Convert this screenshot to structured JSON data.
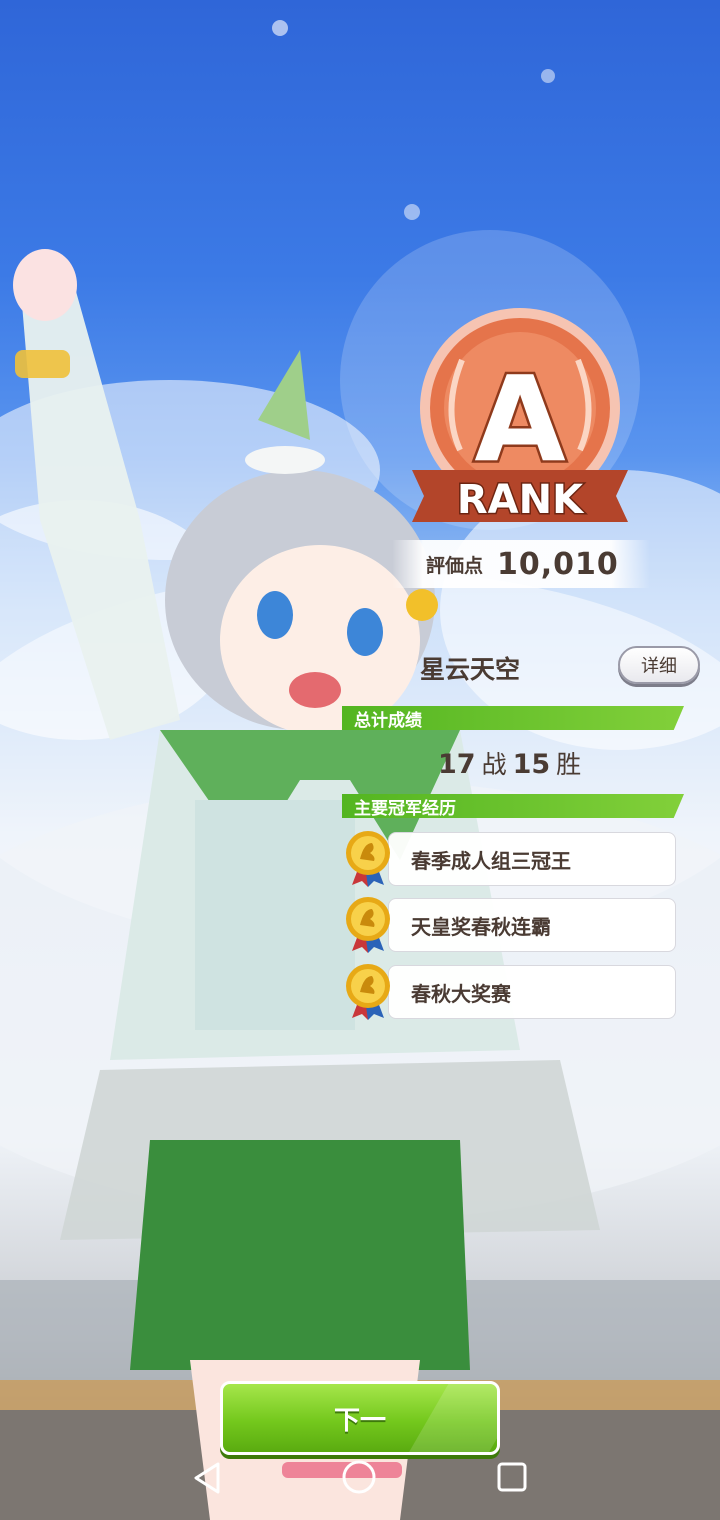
{
  "rank": {
    "letter": "A",
    "label": "RANK"
  },
  "score": {
    "label": "評価点",
    "value": "10,010"
  },
  "character": {
    "name": "星云天空"
  },
  "detail_button": {
    "label": "详细"
  },
  "total_record": {
    "section_label": "总计成绩",
    "races": "17",
    "races_unit": "战",
    "wins": "15",
    "wins_unit": "胜"
  },
  "titles": {
    "section_label": "主要冠军经历",
    "items": [
      {
        "label": "春季成人组三冠王",
        "icon": "gold-medal-icon"
      },
      {
        "label": "天皇奖春秋连霸",
        "icon": "gold-medal-icon"
      },
      {
        "label": "春秋大奖赛",
        "icon": "gold-medal-icon"
      }
    ]
  },
  "next_button": {
    "label": "下一"
  },
  "navbar": {
    "icons": [
      "back-triangle-icon",
      "home-circle-icon",
      "recent-square-icon"
    ]
  },
  "colors": {
    "accent_green": "#6cc21a",
    "rank_bronze": "#e27a52",
    "text_brown": "#4a3b33"
  }
}
